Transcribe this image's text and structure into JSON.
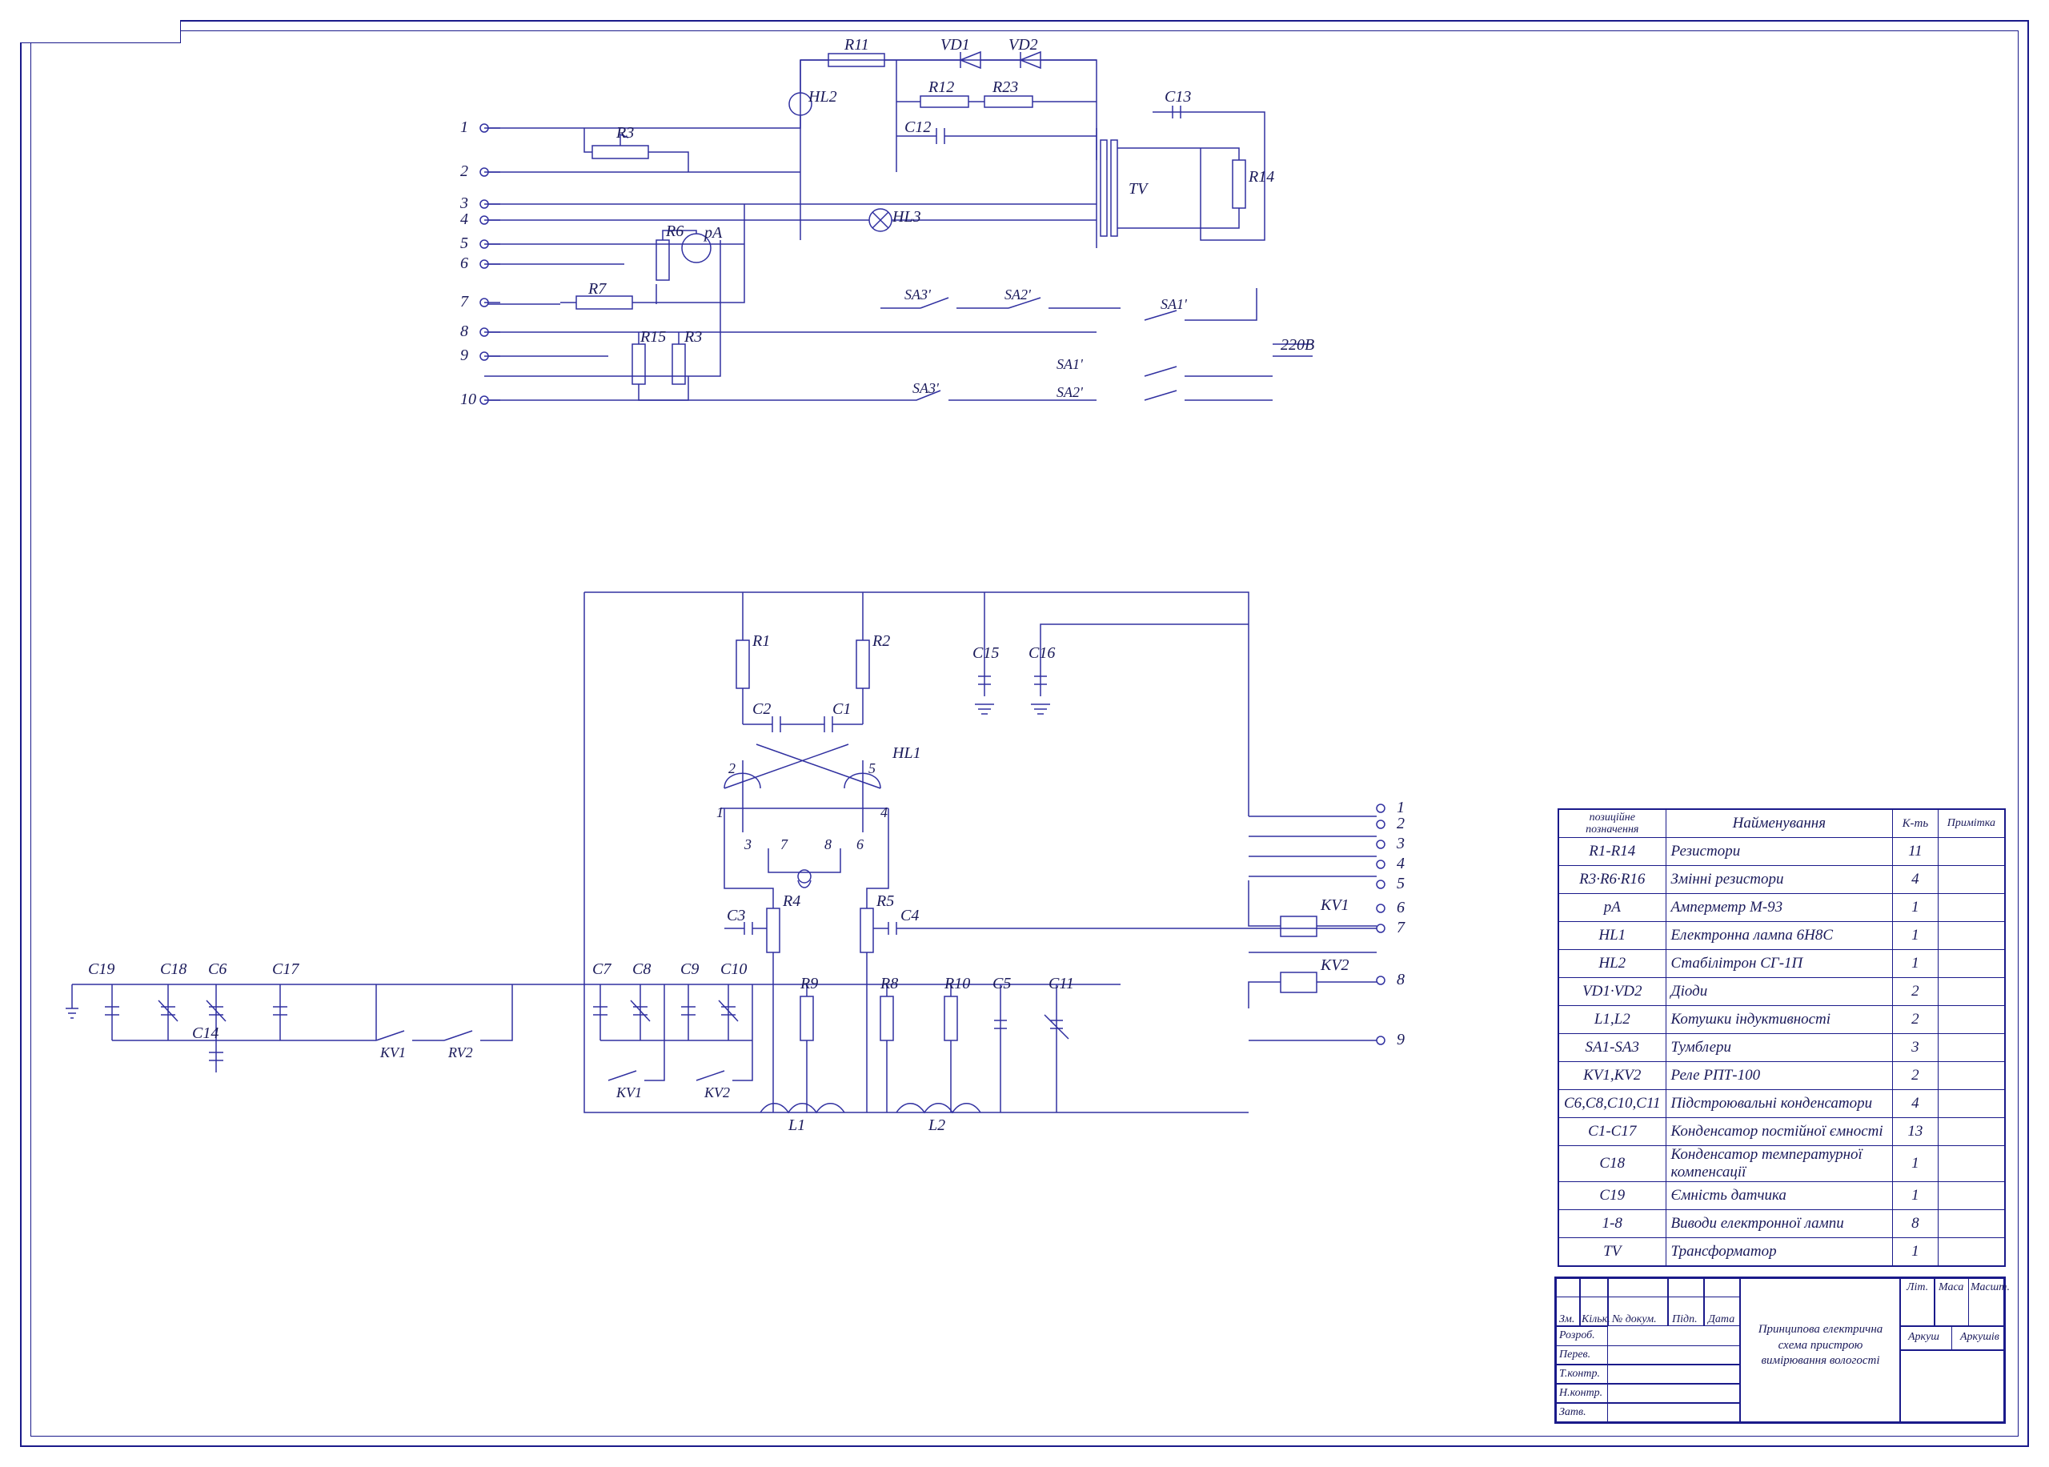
{
  "upper": {
    "terminals": [
      "1",
      "2",
      "3",
      "4",
      "5",
      "6",
      "7",
      "8",
      "9",
      "10"
    ],
    "labels": {
      "R3": "R3",
      "R7": "R7",
      "R6": "R6",
      "pA": "pA",
      "R15": "R15",
      "R3b": "R3",
      "HL2": "HL2",
      "R11": "R11",
      "VD1": "VD1",
      "VD2": "VD2",
      "R12": "R12",
      "R23": "R23",
      "C12": "C12",
      "HL3": "HL3",
      "SA3a": "SA3'",
      "SA3b": "SA3'",
      "SA2a": "SA2'",
      "SA2b": "SA2'",
      "SA1a": "SA1'",
      "SA1b": "SA1'",
      "TV": "TV",
      "C13": "C13",
      "R14": "R14",
      "V220": "220В"
    }
  },
  "lower": {
    "terminals": [
      "1",
      "2",
      "3",
      "4",
      "5",
      "6",
      "7",
      "8",
      "9"
    ],
    "labels": {
      "R1": "R1",
      "R2": "R2",
      "C2": "C2",
      "C1": "C1",
      "HL1": "HL1",
      "p1": "1",
      "p2": "2",
      "p3": "3",
      "p4": "4",
      "p5": "5",
      "p6": "6",
      "p7": "7",
      "p8": "8",
      "R4": "R4",
      "R5": "R5",
      "C3": "C3",
      "C4": "C4",
      "C15": "C15",
      "C16": "C16",
      "C19": "C19",
      "C18": "C18",
      "C6": "C6",
      "C17": "C17",
      "C14": "C14",
      "KV1a": "KV1",
      "RV2": "RV2",
      "KV1b": "KV1",
      "KV2b": "KV2",
      "C7": "C7",
      "C8": "C8",
      "C9": "C9",
      "C10": "C10",
      "R9": "R9",
      "R8": "R8",
      "R10": "R10",
      "C5": "C5",
      "C11": "C11",
      "L1": "L1",
      "L2": "L2",
      "KV1c": "KV1",
      "KV2c": "KV2"
    }
  },
  "bom": {
    "headers": {
      "pos": "позиційне\nпозначення",
      "name": "Найменування",
      "qty": "К-ть",
      "note": "Примітка"
    },
    "rows": [
      {
        "pos": "R1-R14",
        "name": "Резистори",
        "qty": "11",
        "note": ""
      },
      {
        "pos": "R3·R6·R16",
        "name": "Змінні резистори",
        "qty": "4",
        "note": ""
      },
      {
        "pos": "pA",
        "name": "Амперметр М-93",
        "qty": "1",
        "note": ""
      },
      {
        "pos": "HL1",
        "name": "Електронна лампа 6Н8С",
        "qty": "1",
        "note": ""
      },
      {
        "pos": "HL2",
        "name": "Стабілітрон СГ-1П",
        "qty": "1",
        "note": ""
      },
      {
        "pos": "VD1·VD2",
        "name": "Діоди",
        "qty": "2",
        "note": ""
      },
      {
        "pos": "L1,L2",
        "name": "Котушки індуктивності",
        "qty": "2",
        "note": ""
      },
      {
        "pos": "SA1-SA3",
        "name": "Тумблери",
        "qty": "3",
        "note": ""
      },
      {
        "pos": "KV1,KV2",
        "name": "Реле РПТ-100",
        "qty": "2",
        "note": ""
      },
      {
        "pos": "С6,С8,С10,С11",
        "name": "Підстроювальні конденсатори",
        "qty": "4",
        "note": ""
      },
      {
        "pos": "С1-С17",
        "name": "Конденсатор постійної ємності",
        "qty": "13",
        "note": ""
      },
      {
        "pos": "С18",
        "name": "Конденсатор температурної компенсації",
        "qty": "1",
        "note": ""
      },
      {
        "pos": "С19",
        "name": "Ємність датчика",
        "qty": "1",
        "note": ""
      },
      {
        "pos": "1-8",
        "name": "Виводи електронної лампи",
        "qty": "8",
        "note": ""
      },
      {
        "pos": "TV",
        "name": "Трансформатор",
        "qty": "1",
        "note": ""
      }
    ]
  },
  "titleblock": {
    "title": "Принципова електрична схема пристрою вимірювання вологості",
    "cols_left": [
      "Зм.",
      "Кільк.",
      "№ докум.",
      "Підп.",
      "Дата"
    ],
    "rows_left": [
      "Розроб.",
      "Перев.",
      "Т.контр.",
      "Н.контр.",
      "Затв."
    ],
    "cols_right": [
      "Літ.",
      "Маса",
      "Масшт."
    ],
    "ark": "Аркуш",
    "arks": "Аркушів"
  }
}
